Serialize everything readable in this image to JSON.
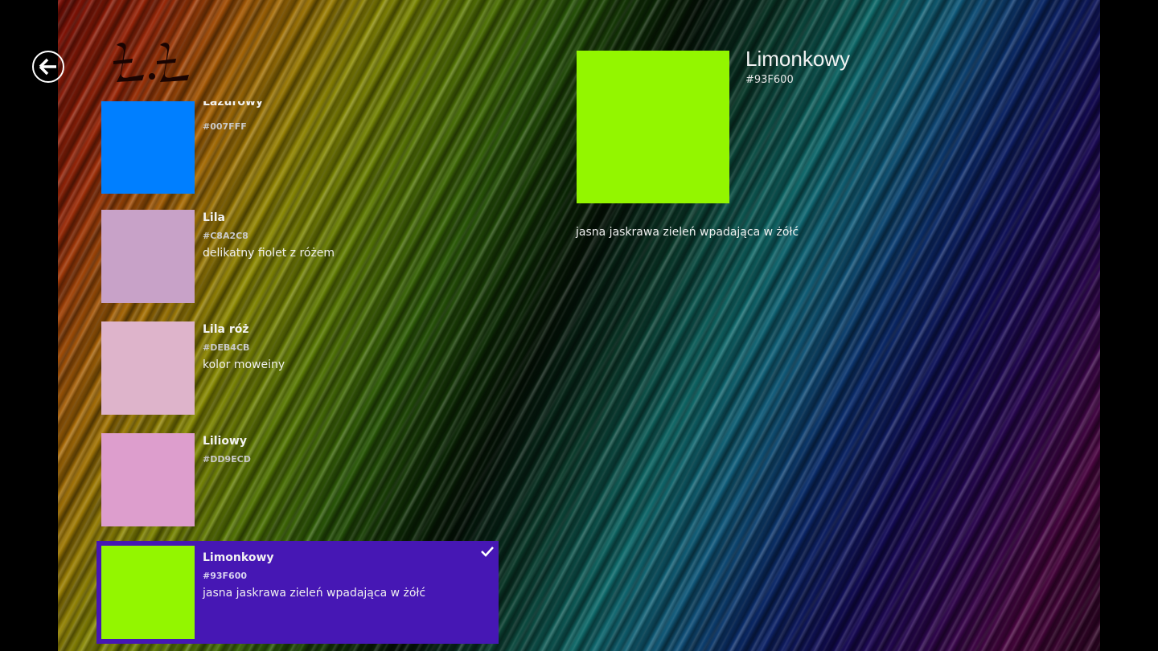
{
  "header": {
    "logo_text": "L.L"
  },
  "colors": [
    {
      "name": "Lazurowy",
      "hex": "#007FFF",
      "description": "",
      "swatch": "#007FFF"
    },
    {
      "name": "Lila",
      "hex": "#C8A2C8",
      "description": "delikatny fiolet z różem",
      "swatch": "#C8A2C8"
    },
    {
      "name": "Lila róż",
      "hex": "#DEB4CB",
      "description": "kolor moweiny",
      "swatch": "#DEB4CB"
    },
    {
      "name": "Liliowy",
      "hex": "#DD9ECD",
      "description": "",
      "swatch": "#DD9ECD"
    },
    {
      "name": "Limonkowy",
      "hex": "#93F600",
      "description": "jasna jaskrawa zieleń wpadająca w żółć",
      "swatch": "#93F600",
      "selected": true
    }
  ],
  "detail": {
    "name": "Limonkowy",
    "hex": "#93F600",
    "description": "jasna jaskrawa zieleń wpadająca w żółć",
    "swatch": "#93F600"
  },
  "theme": {
    "selection_color": "#4617B4"
  },
  "icons": {
    "back": "back-arrow-icon",
    "check": "check-icon"
  }
}
